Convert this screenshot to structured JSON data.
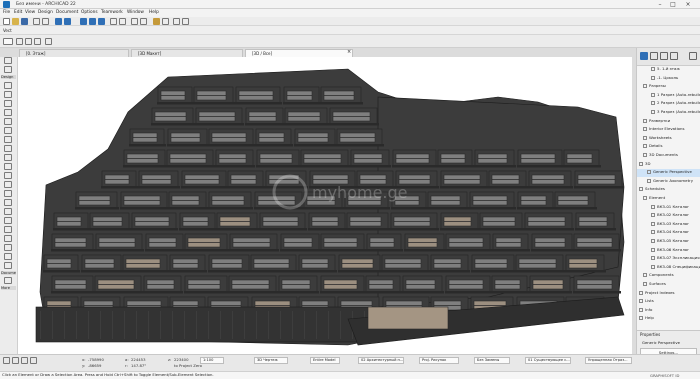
{
  "window": {
    "title": "Без имени - ARCHICAD 22"
  },
  "menu": [
    "File",
    "Edit",
    "View",
    "Design",
    "Document",
    "Options",
    "Teamwork",
    "Window",
    "Help"
  ],
  "tabs": [
    {
      "label": "[0. Этаж]",
      "active": false
    },
    {
      "label": "[3D Макет]",
      "active": false
    },
    {
      "label": "[3D / Все]",
      "active": true
    }
  ],
  "info_strip": {
    "label": "Vect"
  },
  "toolbox": {
    "labels": [
      "Design",
      "Docume",
      "More"
    ]
  },
  "navigator": {
    "items": [
      {
        "label": "5. 1-й этаж",
        "indent": 3,
        "selected": false
      },
      {
        "label": "-1. Цоколь",
        "indent": 3,
        "selected": false
      },
      {
        "label": "Разрезы",
        "indent": 1,
        "selected": false
      },
      {
        "label": "1 Разрез (Auto-rebuild)",
        "indent": 3,
        "selected": false
      },
      {
        "label": "2 Разрез (Auto-rebuild)",
        "indent": 3,
        "selected": false
      },
      {
        "label": "3 Разрез (Auto-rebuild)",
        "indent": 3,
        "selected": false
      },
      {
        "label": "Развертки",
        "indent": 1,
        "selected": false
      },
      {
        "label": "Interior Elevations",
        "indent": 1,
        "selected": false
      },
      {
        "label": "Worksheets",
        "indent": 1,
        "selected": false
      },
      {
        "label": "Details",
        "indent": 1,
        "selected": false
      },
      {
        "label": "3D Documents",
        "indent": 1,
        "selected": false
      },
      {
        "label": "3D",
        "indent": 0,
        "selected": false
      },
      {
        "label": "Generic Perspective",
        "indent": 2,
        "selected": true
      },
      {
        "label": "Generic Axonometry",
        "indent": 2,
        "selected": false
      },
      {
        "label": "Schedules",
        "indent": 0,
        "selected": false
      },
      {
        "label": "Element",
        "indent": 1,
        "selected": false
      },
      {
        "label": "ВКЗ-01 Каталог",
        "indent": 3,
        "selected": false
      },
      {
        "label": "ВКЗ-02 Каталог",
        "indent": 3,
        "selected": false
      },
      {
        "label": "ВКЗ-03 Каталог",
        "indent": 3,
        "selected": false
      },
      {
        "label": "ВКЗ-04 Каталог",
        "indent": 3,
        "selected": false
      },
      {
        "label": "ВКЗ-05 Каталог",
        "indent": 3,
        "selected": false
      },
      {
        "label": "ВКЗ-06 Каталог",
        "indent": 3,
        "selected": false
      },
      {
        "label": "ВКЗ-07 Экспликация",
        "indent": 3,
        "selected": false
      },
      {
        "label": "ВКЗ-08 Спецификация",
        "indent": 3,
        "selected": false
      },
      {
        "label": "Components",
        "indent": 1,
        "selected": false
      },
      {
        "label": "Surfaces",
        "indent": 1,
        "selected": false
      },
      {
        "label": "Project Indexes",
        "indent": 0,
        "selected": false
      },
      {
        "label": "Lists",
        "indent": 0,
        "selected": false
      },
      {
        "label": "Info",
        "indent": 0,
        "selected": false
      },
      {
        "label": "Help",
        "indent": 0,
        "selected": false
      }
    ]
  },
  "properties": {
    "header": "Properties",
    "value": "Generic Perspective",
    "settings_button": "Settings..."
  },
  "status": {
    "coords": [
      {
        "label": "x:",
        "value": "-758990"
      },
      {
        "label": "y:",
        "value": "-86659"
      },
      {
        "label": "a:",
        "value": "224453"
      },
      {
        "label": "r:",
        "value": "147.87°"
      },
      {
        "label": "z:",
        "value": "223400"
      },
      {
        "label": "",
        "value": "to Project Zero"
      }
    ],
    "scale": "1:100",
    "combos": [
      "3D Чертеж",
      "Entire Model",
      "02 Архитектурный п...",
      "Proj. Рисунок",
      "Без Замены",
      "01 Существующее с...",
      "Упрощенная Отраз..."
    ],
    "hint": "Click an Element or Draw a Selection Area. Press and Hold Ctrl+Shift to Toggle Element/Sub-Element Selection.",
    "graphisoft_id": "GRAPHISOFT ID"
  },
  "watermark": "myhome.ge",
  "colors": {
    "facade": "#3c3c3c",
    "slab": "#2a2a2a",
    "glass": "#7f7f7f",
    "glass_warm": "#9c8f80",
    "selected": "#cfe3f7"
  }
}
